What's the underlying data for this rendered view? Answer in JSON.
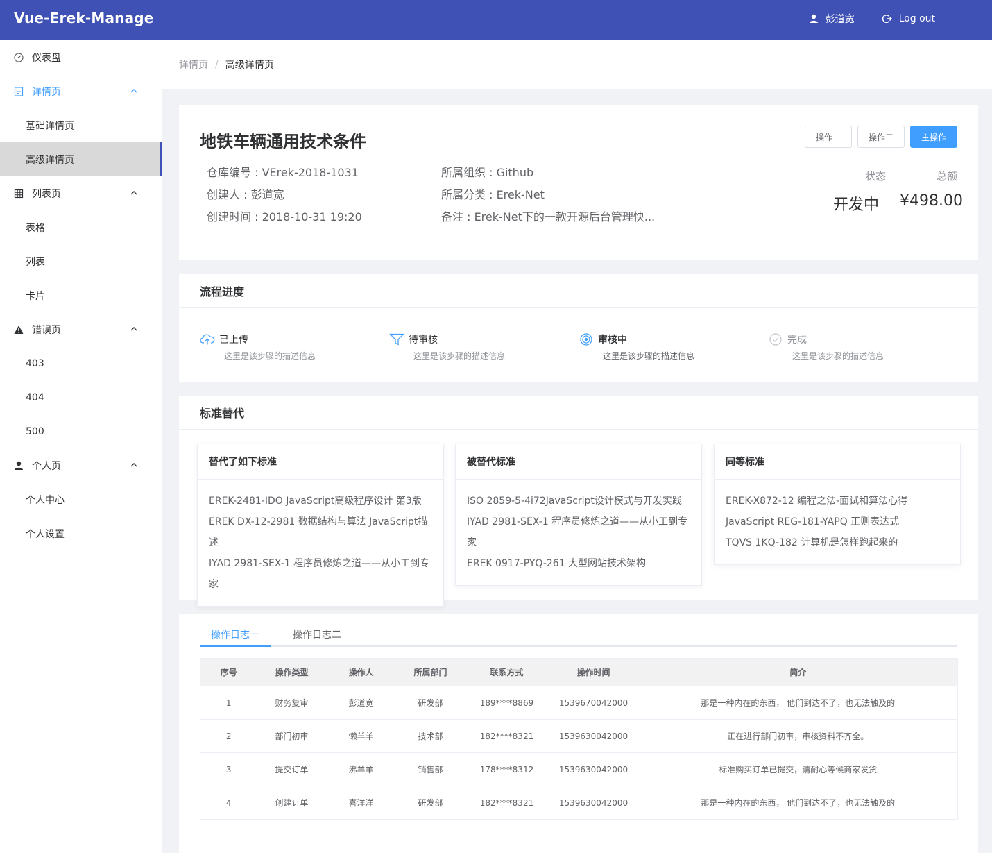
{
  "app": {
    "title": "Vue-Erek-Manage"
  },
  "header": {
    "user_name": "彭道宽",
    "logout_label": "Log out"
  },
  "sidebar": {
    "groups": [
      {
        "label": "仪表盘",
        "icon": "dashboard-icon",
        "expanded": false,
        "items": []
      },
      {
        "label": "详情页",
        "icon": "document-icon",
        "expanded": true,
        "active": true,
        "items": [
          {
            "label": "基础详情页"
          },
          {
            "label": "高级详情页",
            "selected": true
          }
        ]
      },
      {
        "label": "列表页",
        "icon": "grid-icon",
        "expanded": true,
        "items": [
          {
            "label": "表格"
          },
          {
            "label": "列表"
          },
          {
            "label": "卡片"
          }
        ]
      },
      {
        "label": "错误页",
        "icon": "warning-icon",
        "expanded": true,
        "items": [
          {
            "label": "403"
          },
          {
            "label": "404"
          },
          {
            "label": "500"
          }
        ]
      },
      {
        "label": "个人页",
        "icon": "user-icon",
        "expanded": true,
        "items": [
          {
            "label": "个人中心"
          },
          {
            "label": "个人设置"
          }
        ]
      }
    ]
  },
  "breadcrumb": {
    "parent": "详情页",
    "separator": "/",
    "current": "高级详情页"
  },
  "detail": {
    "title": "地铁车辆通用技术条件",
    "info_left": [
      "仓库编号 : VErek-2018-1031",
      "创建人 : 彭道宽",
      "创建时间 : 2018-10-31 19:20"
    ],
    "info_right": [
      "所属组织 : Github",
      "所属分类 : Erek-Net",
      "备注 : Erek-Net下的一款开源后台管理快..."
    ],
    "buttons": {
      "op1": "操作一",
      "op2": "操作二",
      "primary": "主操作"
    },
    "status_label": "状态",
    "amount_label": "总额",
    "status_value": "开发中",
    "amount_value": "¥498.00"
  },
  "process": {
    "title": "流程进度",
    "steps": [
      {
        "label": "已上传",
        "desc": "这里是该步骤的描述信息",
        "state": "done",
        "icon": "cloud-upload-icon"
      },
      {
        "label": "待审核",
        "desc": "这里是该步骤的描述信息",
        "state": "done",
        "icon": "filter-icon"
      },
      {
        "label": "审核中",
        "desc": "这里是该步骤的描述信息",
        "state": "process",
        "icon": "loading-icon"
      },
      {
        "label": "完成",
        "desc": "这里是该步骤的描述信息",
        "state": "wait",
        "icon": "check-circle-icon"
      }
    ]
  },
  "standards": {
    "title": "标准替代",
    "boxes": [
      {
        "title": "替代了如下标准",
        "lines": [
          "EREK-2481-IDO JavaScript高级程序设计 第3版",
          "EREK DX-12-2981 数据结构与算法 JavaScript描述",
          "IYAD 2981-SEX-1 程序员修炼之道——从小工到专",
          "家"
        ]
      },
      {
        "title": "被替代标准",
        "lines": [
          "ISO 2859-5-4i72JavaScript设计模式与开发实践",
          "IYAD 2981-SEX-1 程序员修炼之道——从小工到专",
          "家",
          "EREK 0917-PYQ-261 大型网站技术架构"
        ]
      },
      {
        "title": "同等标准",
        "lines": [
          "EREK-X872-12 编程之法-面试和算法心得",
          "JavaScript REG-181-YAPQ 正则表达式",
          "TQVS 1KQ-182 计算机是怎样跑起来的"
        ]
      }
    ]
  },
  "logs": {
    "tabs": [
      "操作日志一",
      "操作日志二"
    ],
    "active_tab": 0,
    "columns": [
      "序号",
      "操作类型",
      "操作人",
      "所属部门",
      "联系方式",
      "操作时间",
      "简介"
    ],
    "rows": [
      [
        "1",
        "财务复审",
        "彭道宽",
        "研发部",
        "189****8869",
        "1539670042000",
        "那是一种内在的东西， 他们到达不了，也无法触及的"
      ],
      [
        "2",
        "部门初审",
        "懒羊羊",
        "技术部",
        "182****8321",
        "1539630042000",
        "正在进行部门初审，审核资料不齐全。"
      ],
      [
        "3",
        "提交订单",
        "沸羊羊",
        "销售部",
        "178****8312",
        "1539630042000",
        "标准购买订单已提交，请耐心等候商家发货"
      ],
      [
        "4",
        "创建订单",
        "喜洋洋",
        "研发部",
        "182****8321",
        "1539630042000",
        "那是一种内在的东西， 他们到达不了，也无法触及的"
      ]
    ]
  },
  "colors": {
    "header_bg": "#3f51b5",
    "primary": "#409eff",
    "selected_bg": "#d9d9d9"
  }
}
